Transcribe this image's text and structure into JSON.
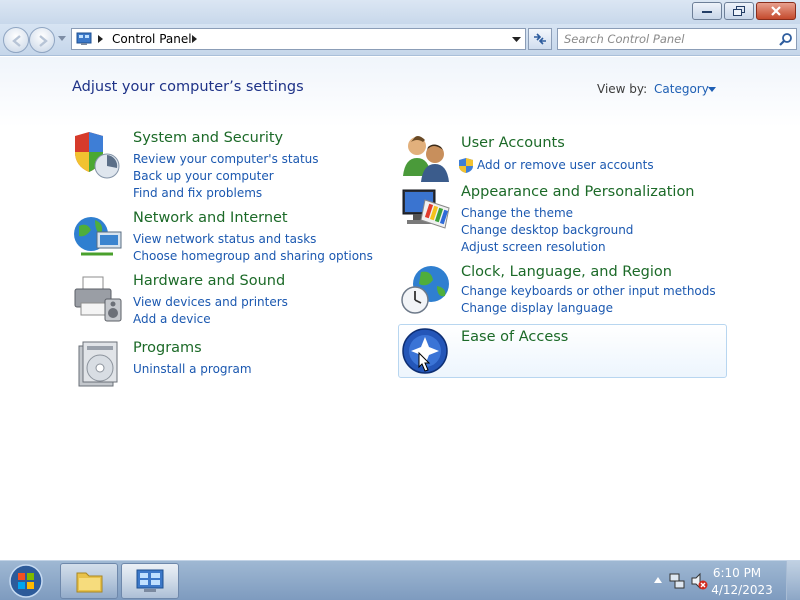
{
  "window": {
    "minimize_icon": "minimize-icon",
    "maximize_icon": "restore-icon",
    "close_icon": "close-icon"
  },
  "navbar": {
    "address_path": "Control Panel",
    "search_placeholder": "Search Control Panel"
  },
  "content": {
    "page_title": "Adjust your computer’s settings",
    "view_by_label": "View by:",
    "view_by_value": "Category"
  },
  "categories": [
    {
      "title": "System and Security",
      "icon": "shield-icon",
      "links": [
        "Review your computer's status",
        "Back up your computer",
        "Find and fix problems"
      ]
    },
    {
      "title": "Network and Internet",
      "icon": "network-globe-icon",
      "links": [
        "View network status and tasks",
        "Choose homegroup and sharing options"
      ]
    },
    {
      "title": "Hardware and Sound",
      "icon": "printer-icon",
      "links": [
        "View devices and printers",
        "Add a device"
      ]
    },
    {
      "title": "Programs",
      "icon": "programs-disc-icon",
      "links": [
        "Uninstall a program"
      ]
    },
    {
      "title": "User Accounts",
      "icon": "users-icon",
      "links": [
        "Add or remove user accounts"
      ]
    },
    {
      "title": "Appearance and Personalization",
      "icon": "monitor-palette-icon",
      "links": [
        "Change the theme",
        "Change desktop background",
        "Adjust screen resolution"
      ]
    },
    {
      "title": "Clock, Language, and Region",
      "icon": "clock-globe-icon",
      "links": [
        "Change keyboards or other input methods",
        "Change display language"
      ]
    },
    {
      "title": "Ease of Access",
      "icon": "ease-of-access-icon",
      "links": []
    }
  ],
  "taskbar": {
    "time": "6:10 PM",
    "date": "4/12/2023"
  }
}
